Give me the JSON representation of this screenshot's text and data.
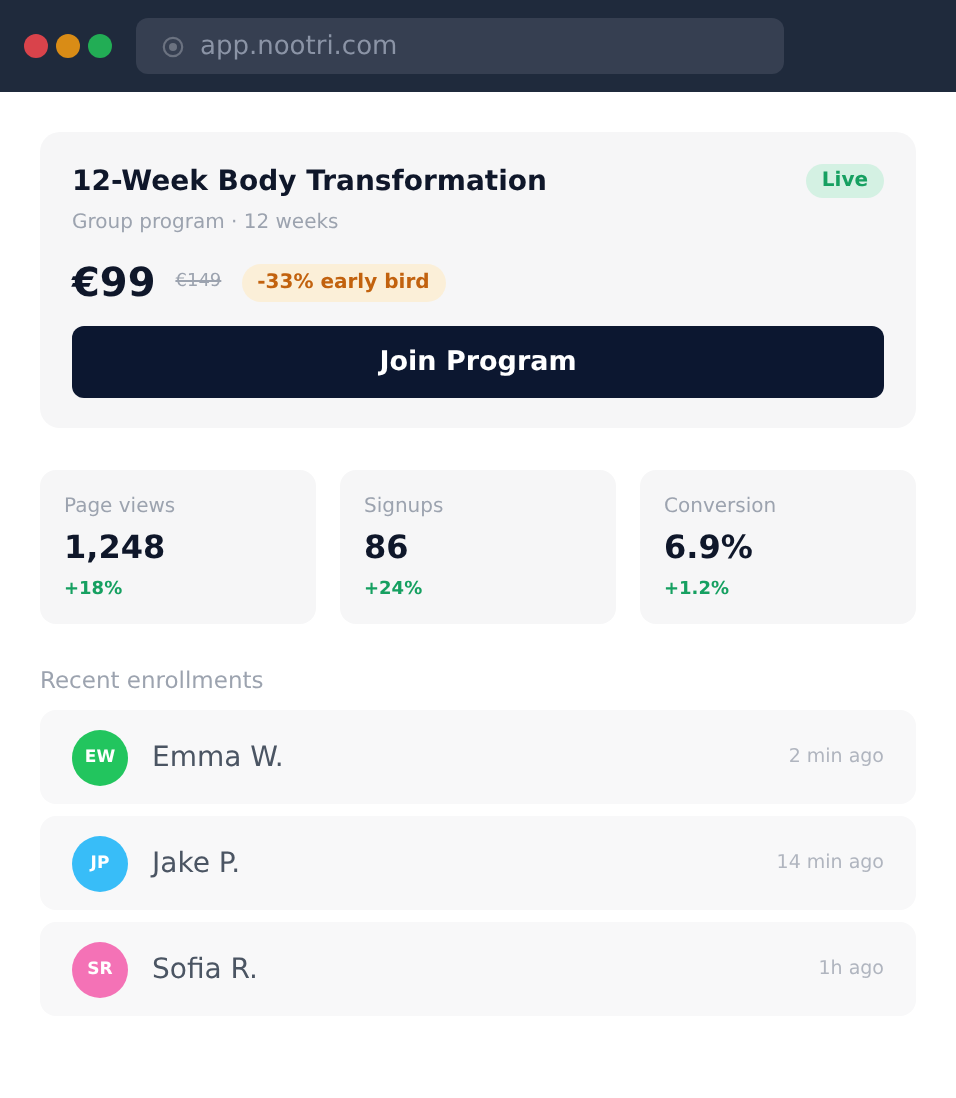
{
  "browser": {
    "url": "app.nootri.com"
  },
  "program": {
    "title": "12-Week Body Transformation",
    "status": "Live",
    "subtitle": "Group program · 12 weeks",
    "price": "€99",
    "old_price": "€149",
    "discount": "-33% early bird",
    "button": "Join Program"
  },
  "stats": [
    {
      "label": "Page views",
      "value": "1,248",
      "change": "+18%"
    },
    {
      "label": "Signups",
      "value": "86",
      "change": "+24%"
    },
    {
      "label": "Conversion",
      "value": "6.9%",
      "change": "+1.2%"
    }
  ],
  "enrollments": {
    "heading": "Recent enrollments",
    "items": [
      {
        "initials": "EW",
        "name": "Emma W.",
        "time": "2 min ago",
        "color": "#22c55e"
      },
      {
        "initials": "JP",
        "name": "Jake P.",
        "time": "14 min ago",
        "color": "#38bdf8"
      },
      {
        "initials": "SR",
        "name": "Sofia R.",
        "time": "1h ago",
        "color": "#f472b6"
      }
    ]
  }
}
